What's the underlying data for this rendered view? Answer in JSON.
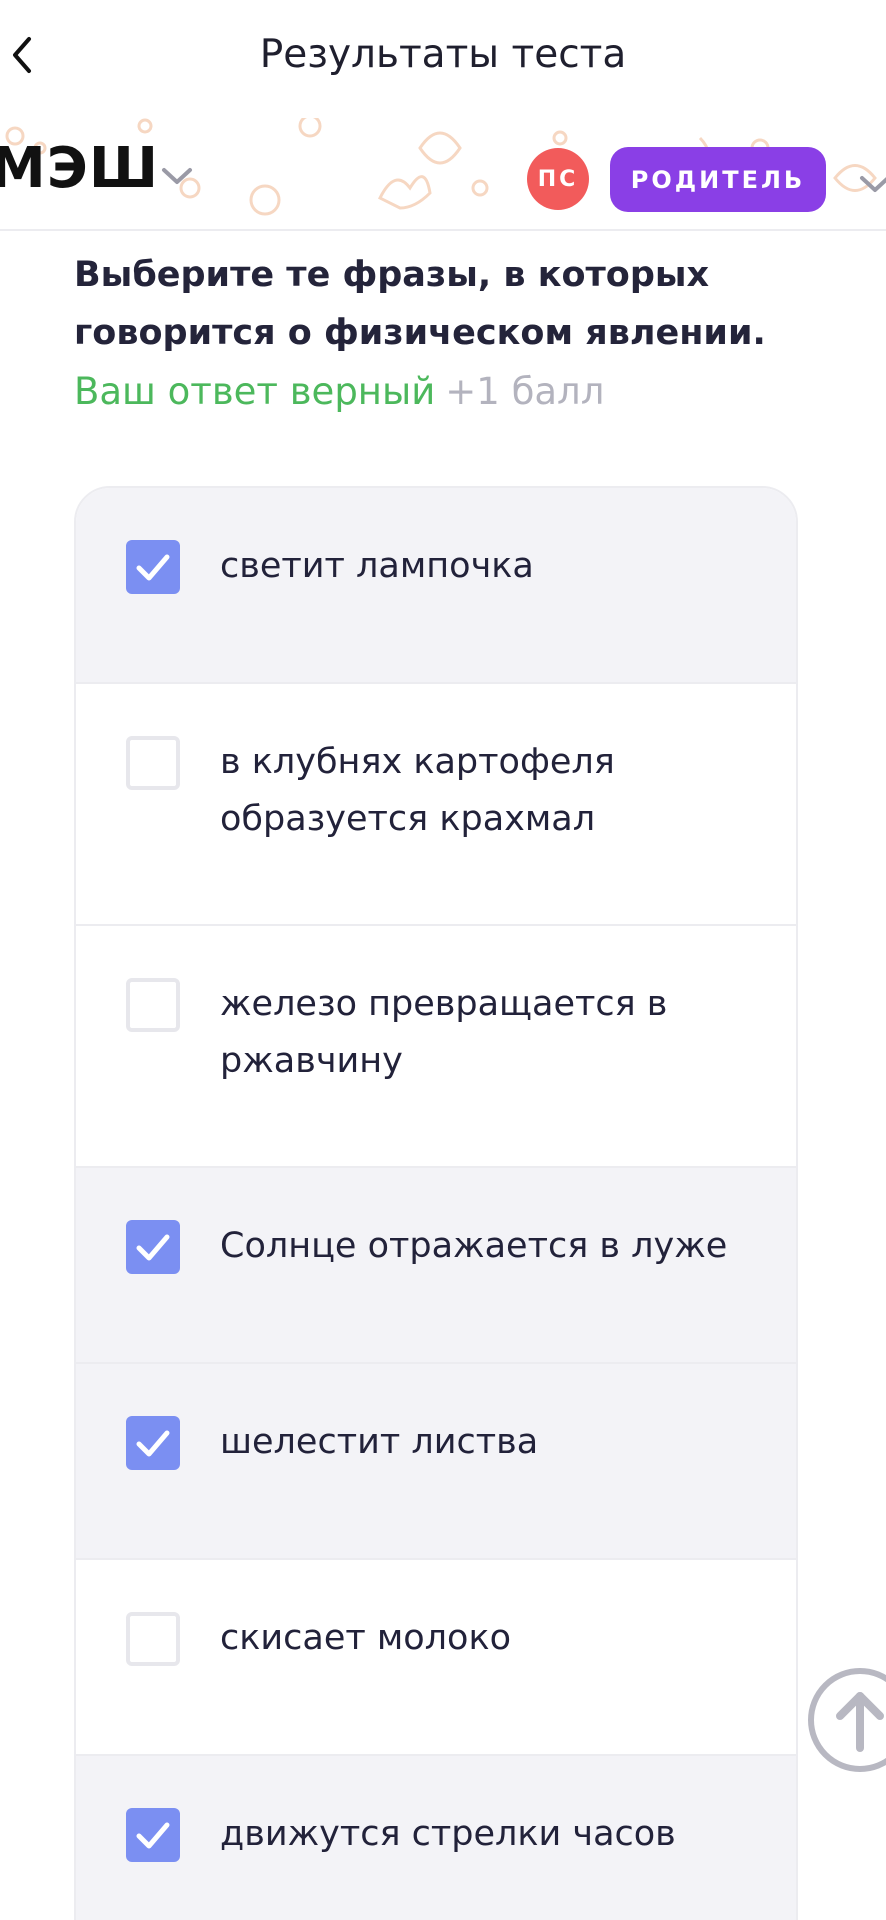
{
  "header": {
    "title": "Результаты теста"
  },
  "brand": {
    "logo": "МЭШ",
    "avatar_initials": "ПС",
    "role_label": "РОДИТЕЛЬ"
  },
  "question": {
    "text": "Выберите те фразы, в которых говорится о физическом явлении.",
    "result_text": "Ваш ответ верный",
    "points": "+1 балл"
  },
  "options": [
    {
      "label": "светит лампочка",
      "checked": true
    },
    {
      "label": "в клубнях картофеля образуется крахмал",
      "checked": false
    },
    {
      "label": "железо превращается в ржавчину",
      "checked": false
    },
    {
      "label": "Солнце отражается в луже",
      "checked": true
    },
    {
      "label": "шелестит листва",
      "checked": true
    },
    {
      "label": "скисает молоко",
      "checked": false
    },
    {
      "label": "движутся стрелки часов",
      "checked": true
    }
  ],
  "colors": {
    "accent": "#7b8ff2",
    "role": "#8a3fe6",
    "avatar": "#f25b5b",
    "correct": "#4cb85c"
  },
  "icons": {
    "back": "chevron-left-icon",
    "dropdown": "chevron-down-icon",
    "check": "checkmark-icon",
    "scroll": "arrow-up-icon"
  }
}
